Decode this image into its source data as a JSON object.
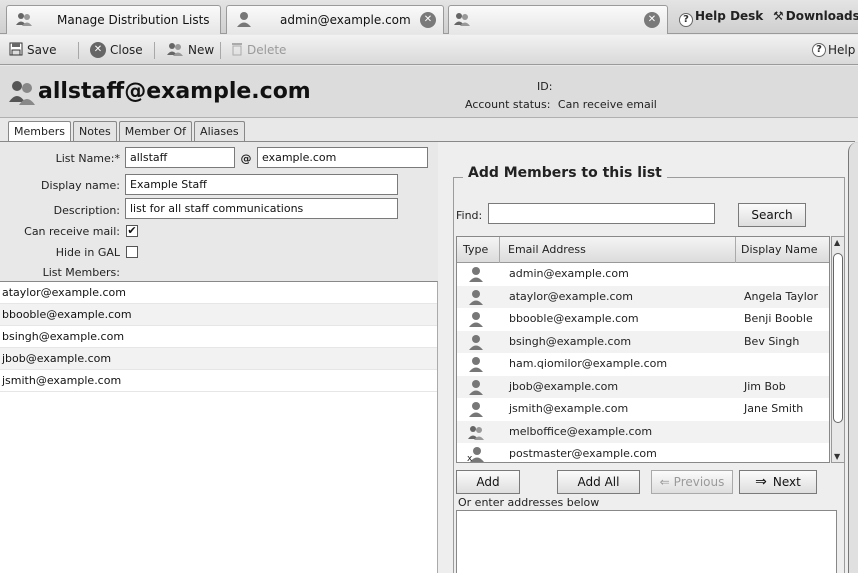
{
  "tabs": [
    {
      "label": "Manage Distribution Lists"
    },
    {
      "label": "admin@example.com"
    },
    {
      "label": ""
    }
  ],
  "top_links": {
    "help_desk": "Help Desk",
    "downloads": "Downloads"
  },
  "toolbar": {
    "save": "Save",
    "close": "Close",
    "new": "New",
    "delete": "Delete",
    "help": "Help"
  },
  "header": {
    "title": "allstaff@example.com",
    "id_label": "ID:",
    "status_label": "Account status:",
    "status_value": "Can receive email"
  },
  "form_tabs": [
    "Members",
    "Notes",
    "Member Of",
    "Aliases"
  ],
  "form": {
    "list_name_label": "List Name:*",
    "list_name_value": "allstaff",
    "at_sign": "@",
    "domain_value": "example.com",
    "display_name_label": "Display name:",
    "display_name_value": "Example Staff",
    "description_label": "Description:",
    "description_value": "list for all staff communications",
    "can_receive_label": "Can receive mail:",
    "can_receive_checked": "✔",
    "hide_gal_label": "Hide in GAL",
    "members_label": "List Members:"
  },
  "list_members": [
    "ataylor@example.com",
    "bbooble@example.com",
    "bsingh@example.com",
    "jbob@example.com",
    "jsmith@example.com"
  ],
  "add_panel": {
    "title": "Add Members to this list",
    "find_label": "Find:",
    "find_value": "",
    "search_button": "Search",
    "columns": {
      "type": "Type",
      "email": "Email Address",
      "display": "Display Name"
    },
    "rows": [
      {
        "email": "admin@example.com",
        "display": "",
        "icon": "user-icon"
      },
      {
        "email": "ataylor@example.com",
        "display": "Angela Taylor",
        "icon": "user-icon"
      },
      {
        "email": "bbooble@example.com",
        "display": "Benji Booble",
        "icon": "user-icon"
      },
      {
        "email": "bsingh@example.com",
        "display": "Bev Singh",
        "icon": "user-icon"
      },
      {
        "email": "ham.qiomilor@example.com",
        "display": "",
        "icon": "user-icon"
      },
      {
        "email": "jbob@example.com",
        "display": "Jim Bob",
        "icon": "user-icon"
      },
      {
        "email": "jsmith@example.com",
        "display": "Jane Smith",
        "icon": "user-icon"
      },
      {
        "email": "melboffice@example.com",
        "display": "",
        "icon": "group-icon"
      },
      {
        "email": "postmaster@example.com",
        "display": "",
        "icon": "alias-icon"
      }
    ],
    "add_button": "Add",
    "add_all_button": "Add All",
    "previous_button": "Previous",
    "next_button": "Next",
    "enter_hint": "Or enter addresses below"
  }
}
